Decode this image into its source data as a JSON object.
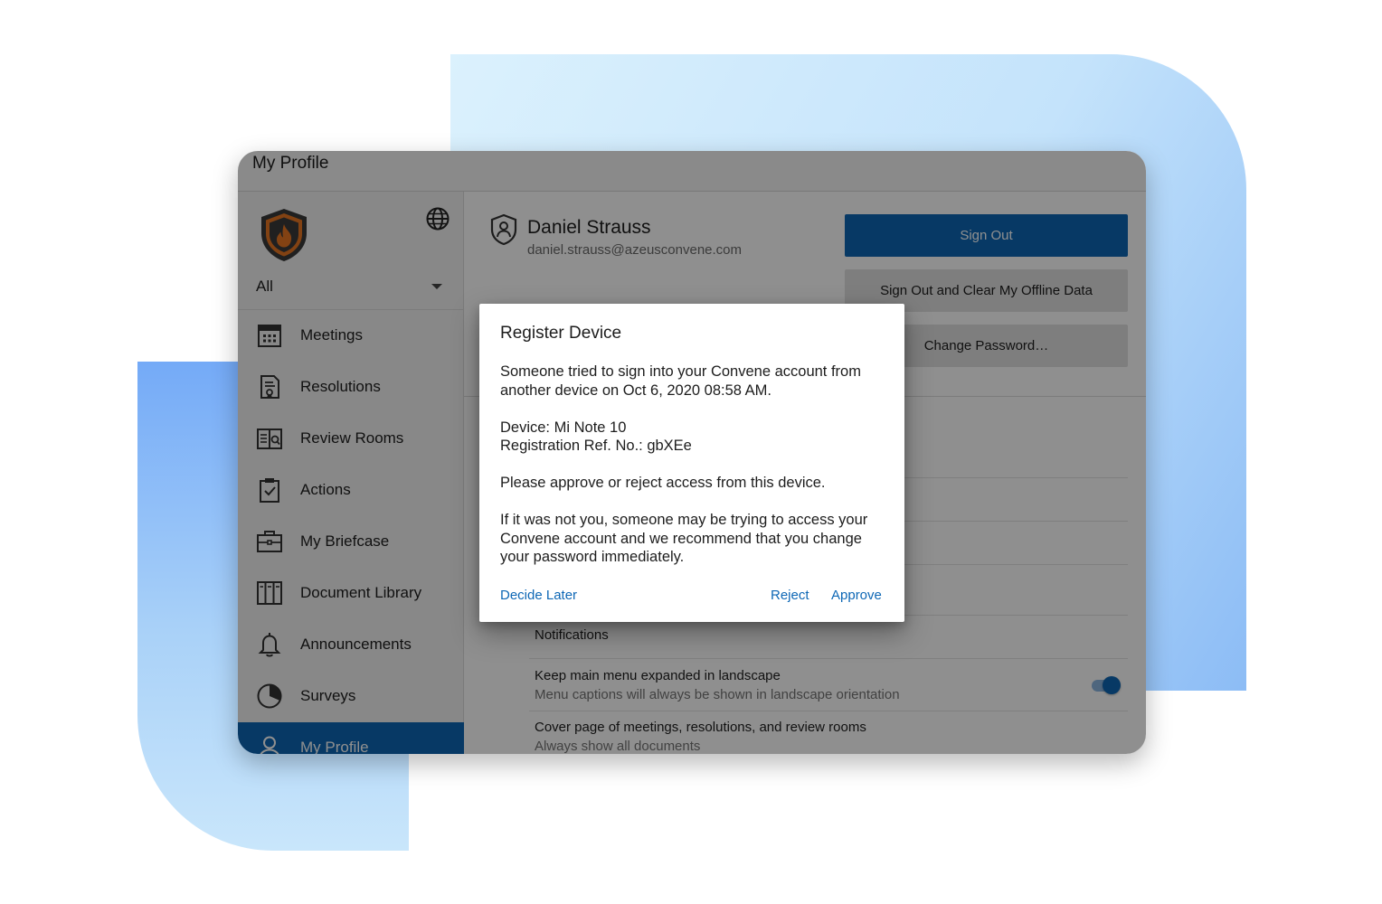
{
  "window": {
    "title": "My Profile"
  },
  "sidebar": {
    "org_select_value": "All",
    "nav_items": [
      {
        "label": "Meetings",
        "icon": "calendar-icon"
      },
      {
        "label": "Resolutions",
        "icon": "certificate-document-icon"
      },
      {
        "label": "Review Rooms",
        "icon": "review-room-icon"
      },
      {
        "label": "Actions",
        "icon": "clipboard-check-icon"
      },
      {
        "label": "My Briefcase",
        "icon": "briefcase-icon"
      },
      {
        "label": "Document Library",
        "icon": "library-icon"
      },
      {
        "label": "Announcements",
        "icon": "bell-icon"
      },
      {
        "label": "Surveys",
        "icon": "pie-chart-icon"
      },
      {
        "label": "My Profile",
        "icon": "user-icon",
        "active": true
      }
    ]
  },
  "profile": {
    "name": "Daniel Strauss",
    "email": "daniel.strauss@azeusconvene.com"
  },
  "actions": {
    "sign_out": "Sign Out",
    "sign_out_clear": "Sign Out and Clear My Offline Data",
    "change_password": "Change Password…"
  },
  "settings": {
    "notifications": "Notifications",
    "keep_menu_title": "Keep main menu expanded in landscape",
    "keep_menu_sub": "Menu captions will always be shown in landscape orientation",
    "keep_menu_enabled": true,
    "cover_page_title": "Cover page of meetings, resolutions, and review rooms",
    "cover_page_sub": "Always show all documents"
  },
  "dialog": {
    "title": "Register Device",
    "line1": "Someone tried to sign into your Convene account from another device on Oct 6, 2020 08:58 AM.",
    "device": "Device: Mi Note 10",
    "registration_ref": "Registration Ref. No.: gbXEe",
    "line3": "Please approve or reject access from this device.",
    "line4": "If it was not you, someone may be trying to access your Convene account and we recommend that you change your password immediately.",
    "decide_later": "Decide Later",
    "reject": "Reject",
    "approve": "Approve"
  },
  "colors": {
    "accent": "#0d67b5",
    "logo_orange": "#e87722",
    "logo_dark": "#3a3a3a"
  }
}
